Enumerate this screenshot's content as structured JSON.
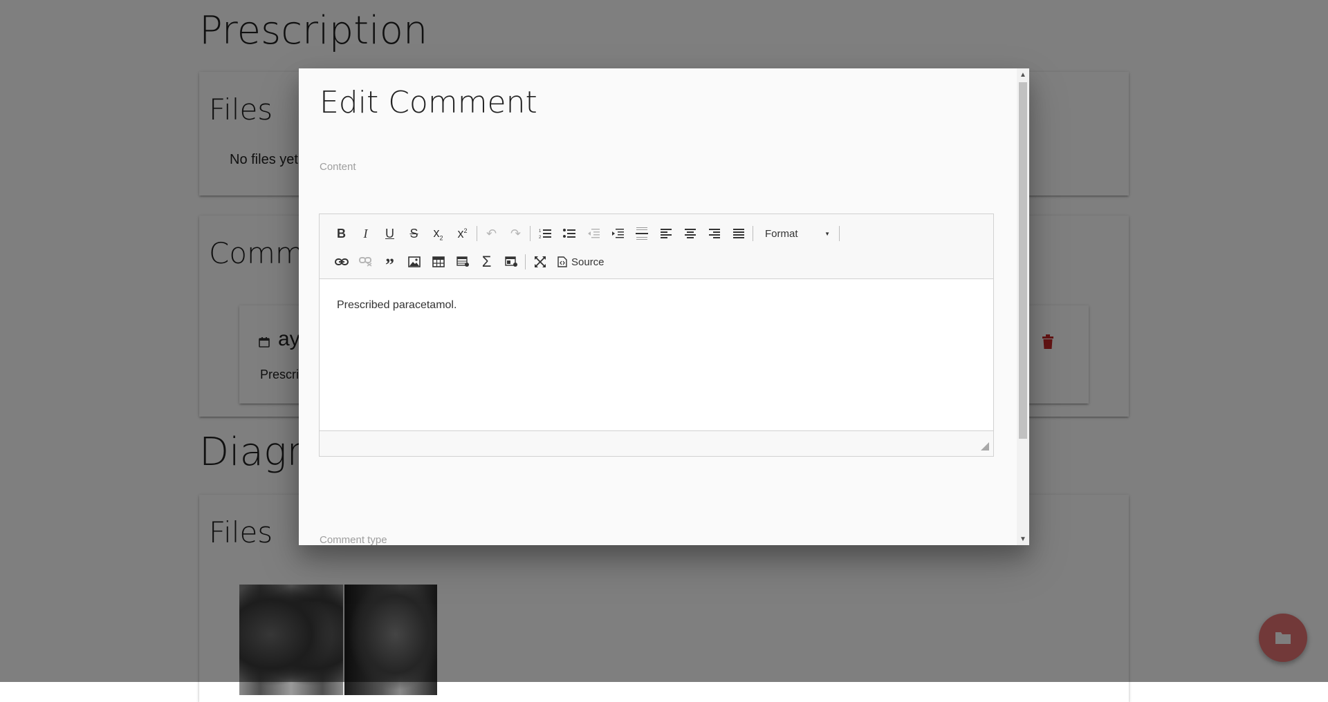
{
  "background": {
    "prescription": {
      "title": "Prescription",
      "files": {
        "title": "Files",
        "empty_text": "No files yet."
      },
      "comments": {
        "title": "Comments",
        "items": [
          {
            "author": "ay",
            "text": "Prescri"
          }
        ]
      }
    },
    "diagnosis": {
      "title": "Diagn",
      "files": {
        "title": "Files"
      }
    },
    "fab_icon": "folder-icon"
  },
  "modal": {
    "title": "Edit Comment",
    "content_label": "Content",
    "toolbar": {
      "format_label": "Format",
      "source_label": "Source"
    },
    "editor_text": "Prescribed paracetamol.",
    "comment_type_label": "Comment type"
  },
  "colors": {
    "delete": "#c62828",
    "fab": "#e57373",
    "overlay": "rgba(0,0,0,0.5)"
  }
}
